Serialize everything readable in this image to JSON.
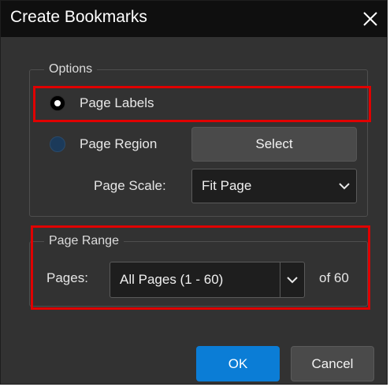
{
  "dialog": {
    "title": "Create Bookmarks",
    "close_icon": "close-icon"
  },
  "options": {
    "legend": "Options",
    "page_labels": {
      "label": "Page Labels",
      "selected": true
    },
    "page_region": {
      "label": "Page Region",
      "selected": false
    },
    "select_button": "Select",
    "page_scale_label": "Page Scale:",
    "page_scale_value": "Fit Page"
  },
  "range": {
    "legend": "Page Range",
    "pages_label": "Pages:",
    "pages_value": "All Pages (1 - 60)",
    "of_total": "of 60"
  },
  "buttons": {
    "ok": "OK",
    "cancel": "Cancel"
  },
  "colors": {
    "highlight": "#e00000",
    "primary": "#0b7dd6",
    "background": "#323232",
    "titlebar": "#0f0f0f"
  }
}
